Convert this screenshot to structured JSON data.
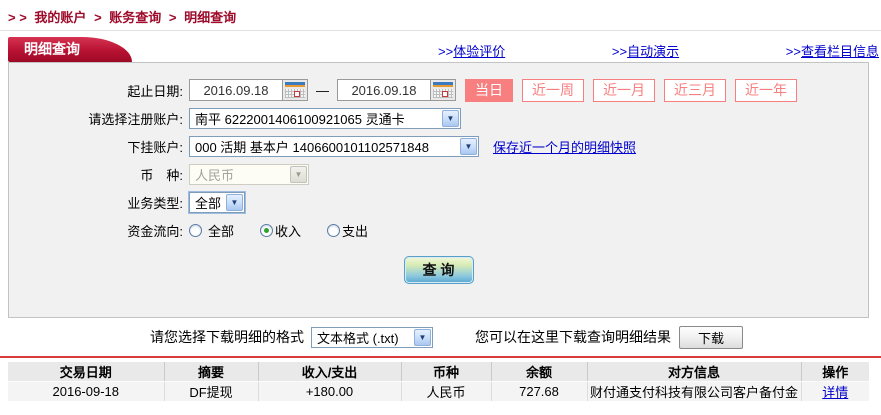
{
  "breadcrumb": {
    "prefix": "> >",
    "separator": ">",
    "items": [
      "我的账户",
      "账务查询",
      "明细查询"
    ]
  },
  "tab": {
    "label": "明细查询"
  },
  "top_links": {
    "experience": {
      "prefix": ">>",
      "label": "体验评价"
    },
    "demo": {
      "prefix": ">>",
      "label": "自动演示"
    },
    "column_info": {
      "prefix": ">>",
      "label": "查看栏目信息"
    }
  },
  "form": {
    "date_label": "起止日期:",
    "date_from": "2016.09.18",
    "date_to": "2016.09.18",
    "date_dash": "—",
    "quick_buttons": [
      {
        "label": "当日",
        "active": true
      },
      {
        "label": "近一周",
        "active": false
      },
      {
        "label": "近一月",
        "active": false
      },
      {
        "label": "近三月",
        "active": false
      },
      {
        "label": "近一年",
        "active": false
      }
    ],
    "account_label": "请选择注册账户:",
    "account_value": "南平 6222001406100921065 灵通卡",
    "sub_account_label": "下挂账户:",
    "sub_account_value": "000 活期 基本户 1406600101102571848",
    "snapshot_link": "保存近一个月的明细快照",
    "currency_label": "币　种:",
    "currency_value": "人民币",
    "biz_type_label": "业务类型:",
    "biz_type_value": "全部",
    "flow_label": "资金流向:",
    "flow_options": [
      {
        "label": "全部",
        "checked": false
      },
      {
        "label": "收入",
        "checked": true
      },
      {
        "label": "支出",
        "checked": false
      }
    ],
    "query_button": "查 询"
  },
  "download": {
    "format_label": "请您选择下载明细的格式",
    "format_value": "文本格式 (.txt)",
    "hint": "您可以在这里下载查询明细结果",
    "button_label": "下载"
  },
  "table": {
    "headers": [
      "交易日期",
      "摘要",
      "收入/支出",
      "币种",
      "余额",
      "对方信息",
      "操作"
    ],
    "rows": [
      {
        "date": "2016-09-18",
        "summary": "DF提现",
        "amount": "+180.00",
        "currency": "人民币",
        "balance": "727.68",
        "counterparty": "财付通支付科技有限公司客户备付金",
        "action": "详情"
      }
    ]
  },
  "colors": {
    "breadcrumb_red": "#9e0b2a",
    "tab_red": "#b81232",
    "quick_button_red": "#f87f7f",
    "link_blue": "#0000cc",
    "amount_red": "#cc0000",
    "table_rule_red": "#d93a3a",
    "panel_bg": "#f1f1f1"
  }
}
